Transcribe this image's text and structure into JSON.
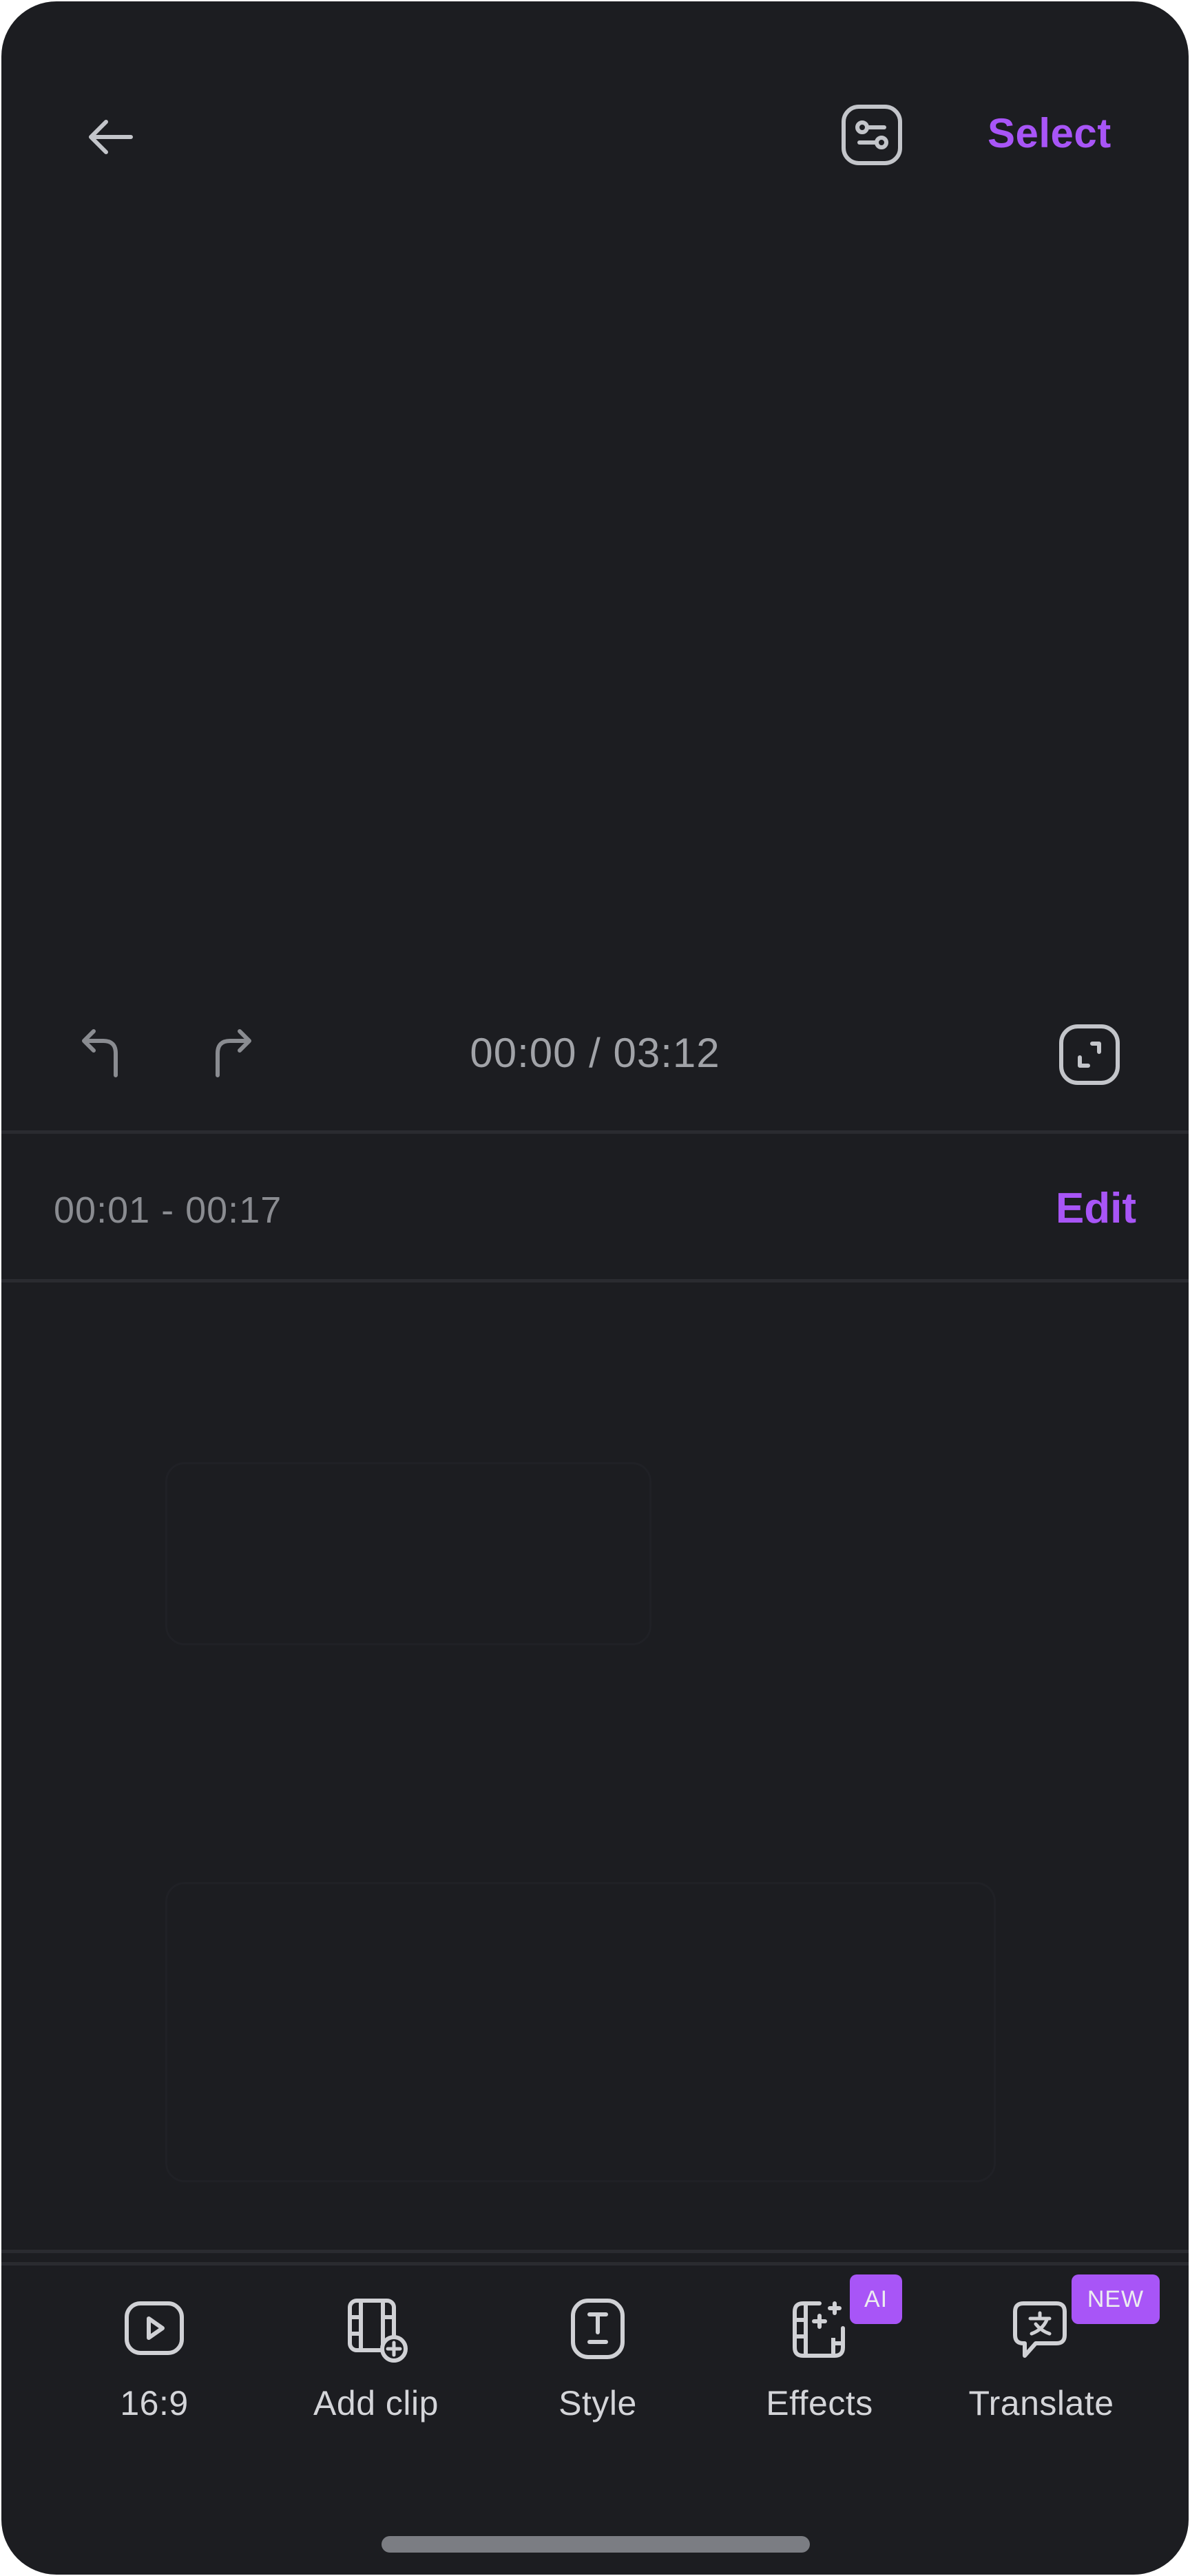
{
  "header": {
    "back_icon": "arrow-left-icon",
    "adjust_icon": "sliders-icon",
    "select_label": "Select"
  },
  "playback": {
    "undo_icon": "undo-icon",
    "redo_icon": "redo-icon",
    "current_time": "00:00",
    "total_time": "03:12",
    "timecode": "00:00 / 03:12",
    "fullscreen_icon": "fullscreen-icon"
  },
  "clip": {
    "range": "00:01 - 00:17",
    "edit_label": "Edit"
  },
  "toolbar": {
    "items": [
      {
        "label": "16:9",
        "icon": "play-square-icon",
        "badge": null
      },
      {
        "label": "Add clip",
        "icon": "film-add-icon",
        "badge": null
      },
      {
        "label": "Style",
        "icon": "text-style-icon",
        "badge": null
      },
      {
        "label": "Effects",
        "icon": "film-sparkle-icon",
        "badge": "AI"
      },
      {
        "label": "Translate",
        "icon": "translate-bubble-icon",
        "badge": "NEW"
      }
    ]
  },
  "colors": {
    "background": "#1c1d21",
    "accent": "#a855f7",
    "icon": "#c8c9ce",
    "muted_text": "#8a8c91",
    "divider": "#2a2b30"
  }
}
